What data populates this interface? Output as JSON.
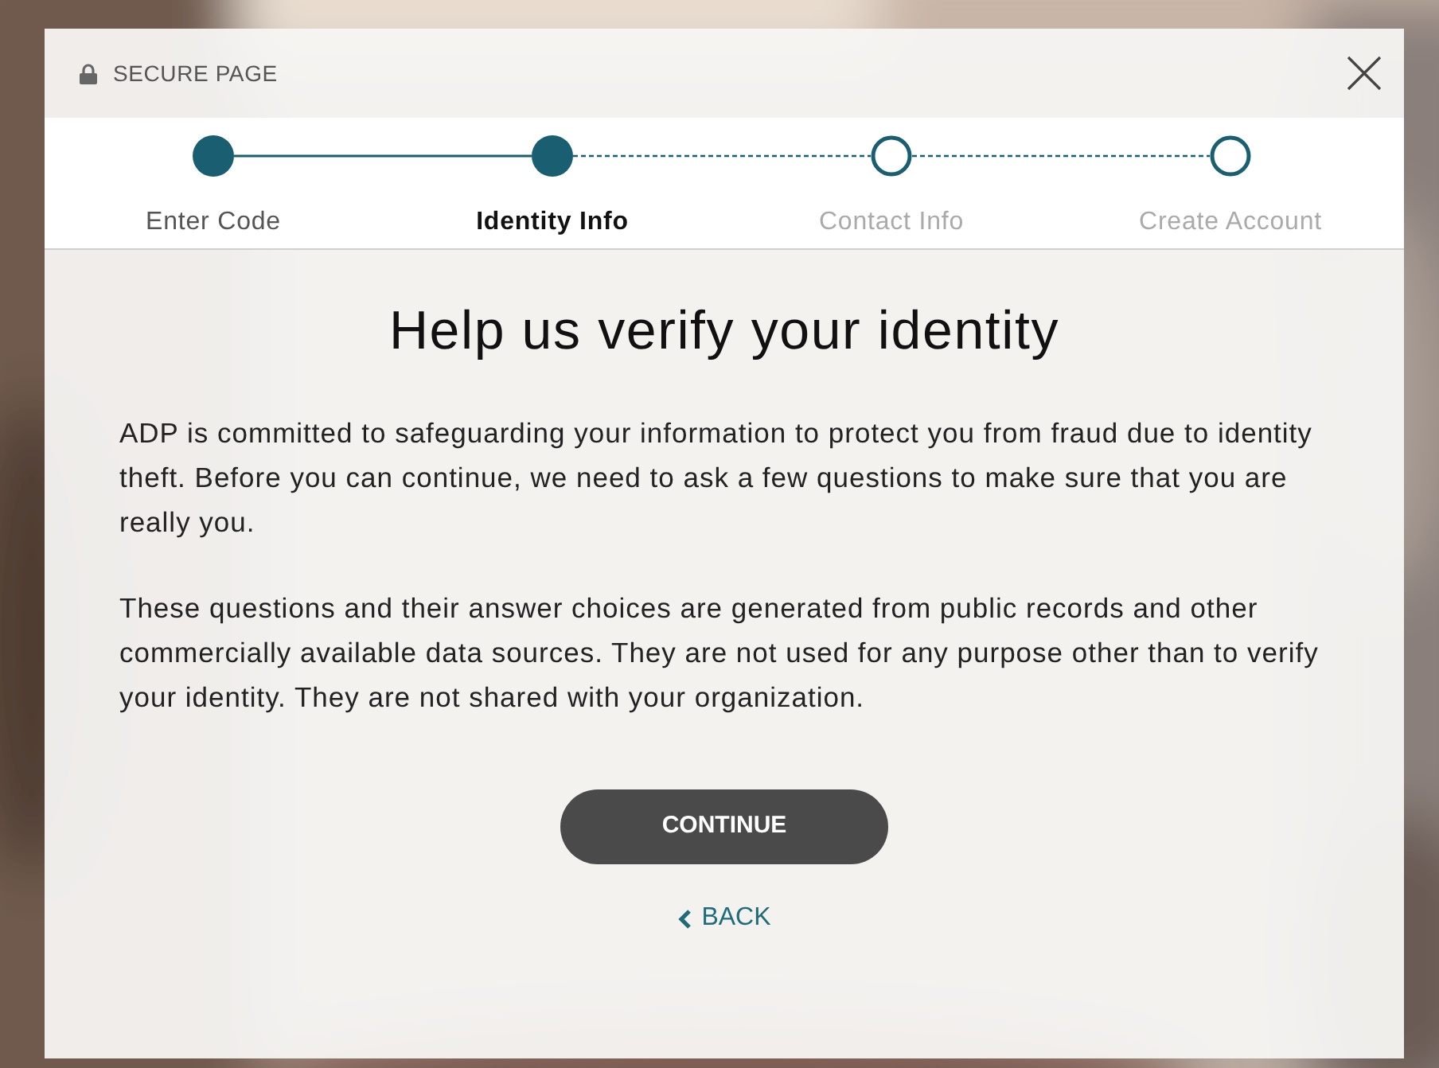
{
  "header": {
    "label": "SECURE PAGE"
  },
  "steps": [
    {
      "label": "Enter Code",
      "kind": "done"
    },
    {
      "label": "Identity Info",
      "kind": "current"
    },
    {
      "label": "Contact Info",
      "kind": "todo"
    },
    {
      "label": "Create Account",
      "kind": "todo"
    }
  ],
  "title": "Help us verify your identity",
  "paragraphs": [
    "ADP is committed to safeguarding your information to protect you from fraud due to identity theft. Before you can continue, we need to ask a few questions to make sure that you are really you.",
    "These questions and their answer choices are generated from public records and other commercially available data sources. They are not used for any purpose other than to verify your identity. They are not shared with your organization."
  ],
  "continue_button": "CONTINUE",
  "back_link": "BACK"
}
